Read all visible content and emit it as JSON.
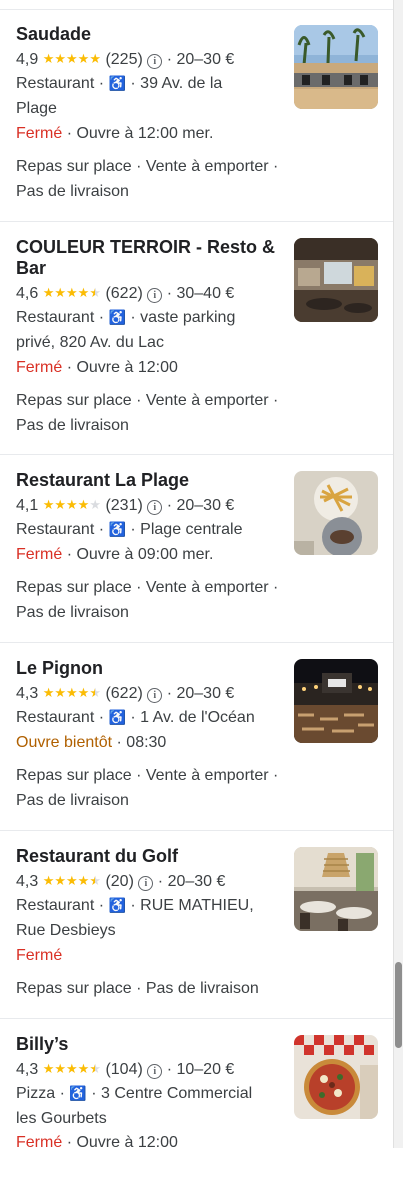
{
  "results": [
    {
      "name": "Saudade",
      "rating": "4,9",
      "stars": 5,
      "reviews": "(225)",
      "price": "20–30 €",
      "category": "Restaurant",
      "address_line1": "39 Av. de la",
      "address_line2": "Plage",
      "status": "Fermé",
      "status_detail": "· Ouvre à 12:00 mer.",
      "services_line1": "Repas sur place · Vente à emporter ·",
      "services_line2": "Pas de livraison"
    },
    {
      "name": "COULEUR TERROIR - Resto & Bar",
      "rating": "4,6",
      "stars": 4.5,
      "reviews": "(622)",
      "price": "30–40 €",
      "category": "Restaurant",
      "address_line1": "vaste parking",
      "address_line2": "privé, 820 Av. du Lac",
      "status": "Fermé",
      "status_detail": "· Ouvre à 12:00",
      "services_line1": "Repas sur place · Vente à emporter ·",
      "services_line2": "Pas de livraison"
    },
    {
      "name": "Restaurant La Plage",
      "rating": "4,1",
      "stars": 4,
      "reviews": "(231)",
      "price": "20–30 €",
      "category": "Restaurant",
      "address_line1": "Plage centrale",
      "address_line2": "",
      "status": "Fermé",
      "status_detail": "· Ouvre à 09:00 mer.",
      "services_line1": "Repas sur place · Vente à emporter ·",
      "services_line2": "Pas de livraison"
    },
    {
      "name": "Le Pignon",
      "rating": "4,3",
      "stars": 4.5,
      "reviews": "(622)",
      "price": "20–30 €",
      "category": "Restaurant",
      "address_line1": "1 Av. de l'Océan",
      "address_line2": "",
      "status": "Ouvre bientôt",
      "status_detail": "· 08:30",
      "services_line1": "Repas sur place · Vente à emporter ·",
      "services_line2": "Pas de livraison"
    },
    {
      "name": "Restaurant du Golf",
      "rating": "4,3",
      "stars": 4.5,
      "reviews": "(20)",
      "price": "20–30 €",
      "category": "Restaurant",
      "address_line1": "RUE MATHIEU,",
      "address_line2": "Rue Desbieys",
      "status": "Fermé",
      "status_detail": "",
      "services_line1": "Repas sur place · Pas de livraison",
      "services_line2": ""
    },
    {
      "name": "Billy’s",
      "rating": "4,3",
      "stars": 4.5,
      "reviews": "(104)",
      "price": "10–20 €",
      "category": "Pizza",
      "address_line1": "3 Centre Commercial",
      "address_line2": "les Gourbets",
      "status": "Fermé",
      "status_detail": "· Ouvre à 12:00",
      "services_line1": "",
      "services_line2": ""
    }
  ],
  "icons": {
    "info": "info-icon",
    "accessibility": "wheelchair-icon",
    "star": "star-icon"
  },
  "colors": {
    "star": "#fbbc04",
    "closed": "#d93025",
    "opening_soon": "#b06000",
    "accessibility": "#1a73e8"
  }
}
